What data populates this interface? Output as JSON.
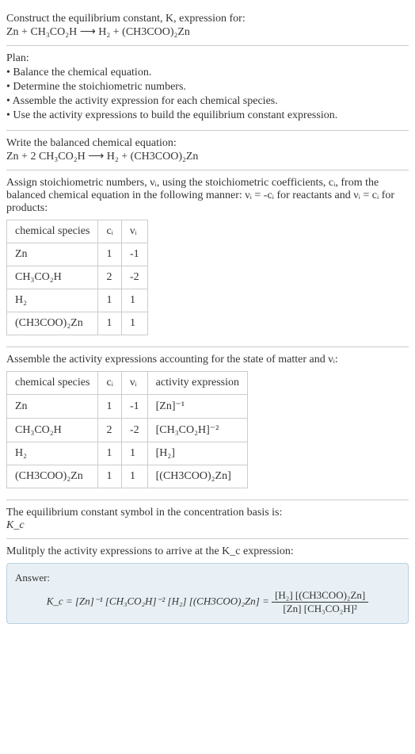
{
  "intro": {
    "line1": "Construct the equilibrium constant, K, expression for:",
    "equation": "Zn + CH₃CO₂H ⟶ H₂ + (CH3COO)₂Zn"
  },
  "plan": {
    "heading": "Plan:",
    "b1": "• Balance the chemical equation.",
    "b2": "• Determine the stoichiometric numbers.",
    "b3": "• Assemble the activity expression for each chemical species.",
    "b4": "• Use the activity expressions to build the equilibrium constant expression."
  },
  "balanced": {
    "heading": "Write the balanced chemical equation:",
    "equation": "Zn + 2 CH₃CO₂H ⟶ H₂ + (CH3COO)₂Zn"
  },
  "stoich": {
    "text_a": "Assign stoichiometric numbers, νᵢ, using the stoichiometric coefficients, cᵢ, from the balanced chemical equation in the following manner: νᵢ = -cᵢ for reactants and νᵢ = cᵢ for products:",
    "h1": "chemical species",
    "h2": "cᵢ",
    "h3": "νᵢ",
    "r1": {
      "s": "Zn",
      "c": "1",
      "v": "-1"
    },
    "r2": {
      "s": "CH₃CO₂H",
      "c": "2",
      "v": "-2"
    },
    "r3": {
      "s": "H₂",
      "c": "1",
      "v": "1"
    },
    "r4": {
      "s": "(CH3COO)₂Zn",
      "c": "1",
      "v": "1"
    }
  },
  "activity": {
    "heading": "Assemble the activity expressions accounting for the state of matter and νᵢ:",
    "h1": "chemical species",
    "h2": "cᵢ",
    "h3": "νᵢ",
    "h4": "activity expression",
    "r1": {
      "s": "Zn",
      "c": "1",
      "v": "-1",
      "a": "[Zn]⁻¹"
    },
    "r2": {
      "s": "CH₃CO₂H",
      "c": "2",
      "v": "-2",
      "a": "[CH₃CO₂H]⁻²"
    },
    "r3": {
      "s": "H₂",
      "c": "1",
      "v": "1",
      "a": "[H₂]"
    },
    "r4": {
      "s": "(CH3COO)₂Zn",
      "c": "1",
      "v": "1",
      "a": "[(CH3COO)₂Zn]"
    }
  },
  "symbol": {
    "line1": "The equilibrium constant symbol in the concentration basis is:",
    "line2": "K_c"
  },
  "multiply": {
    "heading": "Mulitply the activity expressions to arrive at the K_c expression:"
  },
  "answer": {
    "label": "Answer:",
    "lhs": "K_c = [Zn]⁻¹ [CH₃CO₂H]⁻² [H₂] [(CH3COO)₂Zn] =",
    "num": "[H₂] [(CH3COO)₂Zn]",
    "den": "[Zn] [CH₃CO₂H]²"
  }
}
